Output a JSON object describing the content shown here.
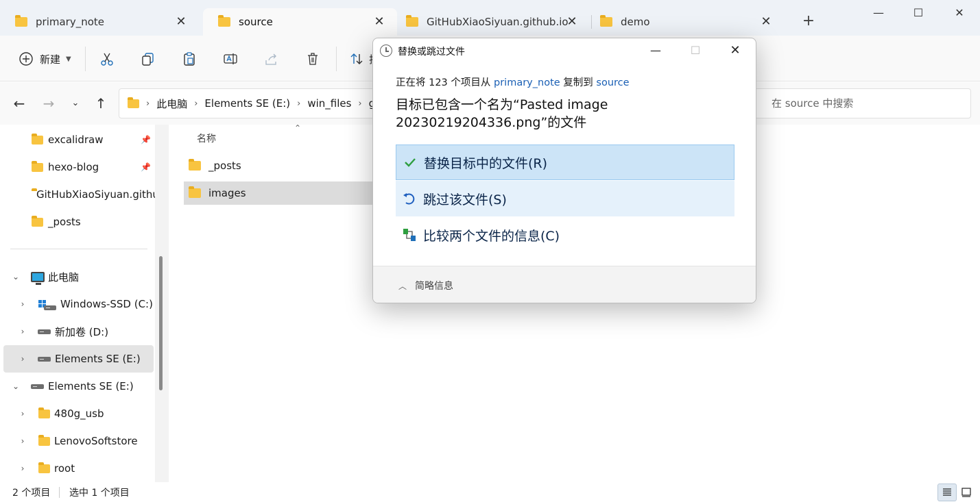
{
  "tabs": [
    {
      "label": "primary_note"
    },
    {
      "label": "source"
    },
    {
      "label": "GitHubXiaoSiyuan.github.io"
    },
    {
      "label": "demo"
    }
  ],
  "toolbar": {
    "new_label": "新建",
    "partial_label": "排"
  },
  "address": {
    "crumbs": [
      "此电脑",
      "Elements SE (E:)",
      "win_files",
      "gi"
    ],
    "search_placeholder": "在 source 中搜索"
  },
  "sidebar": {
    "quick_access": [
      {
        "label": "excalidraw",
        "pinned": true
      },
      {
        "label": "hexo-blog",
        "pinned": true
      },
      {
        "label": "GitHubXiaoSiyuan.github.io",
        "pinned": false
      },
      {
        "label": "_posts",
        "pinned": false
      }
    ],
    "this_pc": "此电脑",
    "drives": [
      "Windows-SSD (C:)",
      "新加卷 (D:)",
      "Elements SE (E:)"
    ],
    "elements": "Elements SE (E:)",
    "folders": [
      "480g_usb",
      "LenovoSoftstore",
      "root"
    ]
  },
  "filelist": {
    "column_name": "名称",
    "rows": [
      "_posts",
      "images"
    ]
  },
  "status": {
    "count": "2 个项目",
    "selected": "选中 1 个项目"
  },
  "dialog": {
    "title": "替换或跳过文件",
    "line1_prefix": "正在将 123 个项目从 ",
    "source_folder": "primary_note",
    "line1_middle": " 复制到 ",
    "target_folder": "source",
    "line2": "目标已包含一个名为“Pasted image 20230219204336.png”的文件",
    "option_replace": "替换目标中的文件(R)",
    "option_skip": "跳过该文件(S)",
    "option_compare": "比较两个文件的信息(C)",
    "details": "简略信息"
  },
  "colors": {
    "folder": "#f8c440",
    "link": "#1a5fb4",
    "replace_bg": "#cce4f7",
    "skip_bg": "#e5f1fb",
    "check": "#2e9e3f"
  }
}
